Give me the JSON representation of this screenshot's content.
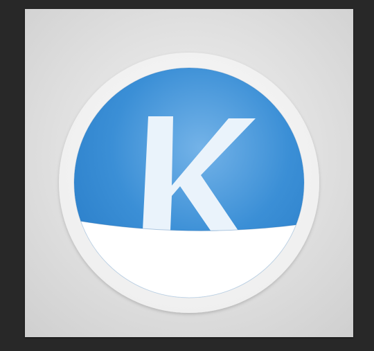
{
  "colors": {
    "workspace_bg": "#282828",
    "ring": "#f3f3f3",
    "disc_blue": "#2e86d0",
    "disc_blue_light": "#6fb0e6",
    "letter": "#eaf3fb",
    "bottom_band": "#ffffff"
  },
  "logo": {
    "letter": "K",
    "icon": "k-letter-logo-icon"
  }
}
